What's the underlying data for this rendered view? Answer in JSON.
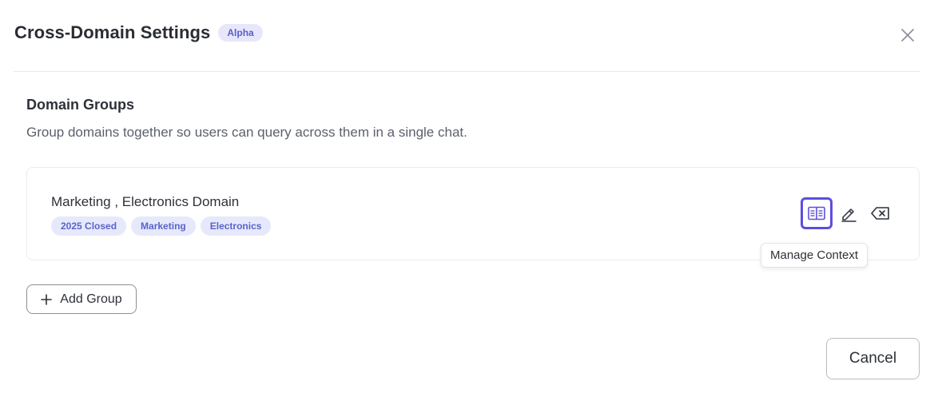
{
  "dialog": {
    "title": "Cross-Domain Settings",
    "badge": "Alpha",
    "close_icon": "close-icon"
  },
  "section": {
    "title": "Domain Groups",
    "description": "Group domains together so users can query across them in a single chat."
  },
  "groups": [
    {
      "name": "Marketing , Electronics Domain",
      "tags": [
        "2025 Closed",
        "Marketing",
        "Electronics"
      ],
      "actions": [
        {
          "icon": "manage-context-icon",
          "active": true
        },
        {
          "icon": "edit-icon",
          "active": false
        },
        {
          "icon": "delete-icon",
          "active": false
        }
      ]
    }
  ],
  "tooltip": "Manage Context",
  "add_group": {
    "icon": "plus-icon",
    "label": "Add Group"
  },
  "cancel_label": "Cancel",
  "colors": {
    "accent": "#5b4fe0",
    "badge_bg": "#e6e7fb",
    "badge_text": "#5b5fc7"
  }
}
